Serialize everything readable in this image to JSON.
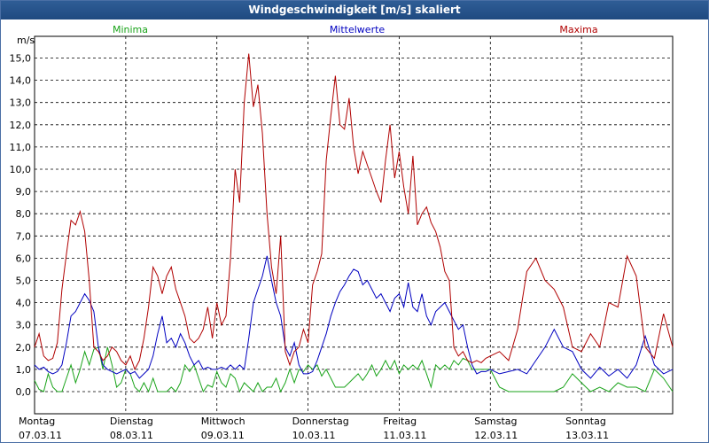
{
  "title": "Windgeschwindigkeit [m/s] skaliert",
  "chart_data": {
    "type": "line",
    "title": "Windgeschwindigkeit [m/s] skaliert",
    "ylabel": "m/s",
    "ylim": [
      0,
      15.5
    ],
    "y_ticks": [
      "0,0",
      "1,0",
      "2,0",
      "3,0",
      "4,0",
      "5,0",
      "6,0",
      "7,0",
      "8,0",
      "9,0",
      "10,0",
      "11,0",
      "12,0",
      "13,0",
      "14,0",
      "15,0"
    ],
    "x_days": [
      {
        "weekday": "Montag",
        "date": "07.03.11"
      },
      {
        "weekday": "Dienstag",
        "date": "08.03.11"
      },
      {
        "weekday": "Mittwoch",
        "date": "09.03.11"
      },
      {
        "weekday": "Donnerstag",
        "date": "10.03.11"
      },
      {
        "weekday": "Freitag",
        "date": "11.03.11"
      },
      {
        "weekday": "Samstag",
        "date": "12.03.11"
      },
      {
        "weekday": "Sonntag",
        "date": "13.03.11"
      }
    ],
    "x_unit": "days since 07.03.11 00:00",
    "grid": true,
    "series": [
      {
        "name": "Minima",
        "color": "#1aa31a",
        "x": [
          0,
          0.05,
          0.1,
          0.15,
          0.2,
          0.25,
          0.3,
          0.35,
          0.4,
          0.45,
          0.5,
          0.55,
          0.6,
          0.65,
          0.7,
          0.75,
          0.8,
          0.85,
          0.9,
          0.95,
          1.0,
          1.05,
          1.1,
          1.15,
          1.2,
          1.25,
          1.3,
          1.35,
          1.4,
          1.45,
          1.5,
          1.55,
          1.6,
          1.65,
          1.7,
          1.75,
          1.8,
          1.85,
          1.9,
          1.95,
          2.0,
          2.05,
          2.1,
          2.15,
          2.2,
          2.25,
          2.3,
          2.35,
          2.4,
          2.45,
          2.5,
          2.55,
          2.6,
          2.65,
          2.7,
          2.75,
          2.8,
          2.85,
          2.9,
          2.95,
          3.0,
          3.05,
          3.1,
          3.15,
          3.2,
          3.25,
          3.3,
          3.35,
          3.4,
          3.45,
          3.5,
          3.55,
          3.6,
          3.65,
          3.7,
          3.75,
          3.8,
          3.85,
          3.9,
          3.95,
          4.0,
          4.05,
          4.1,
          4.15,
          4.2,
          4.25,
          4.3,
          4.35,
          4.4,
          4.45,
          4.5,
          4.55,
          4.6,
          4.65,
          4.7,
          4.75,
          4.8,
          4.85,
          4.9,
          4.95,
          5.0,
          5.1,
          5.2,
          5.3,
          5.4,
          5.5,
          5.6,
          5.7,
          5.8,
          5.9,
          6.0,
          6.1,
          6.2,
          6.3,
          6.4,
          6.5,
          6.6,
          6.7,
          6.8,
          6.9,
          7.0
        ],
        "values": [
          0.5,
          0.1,
          0.0,
          0.8,
          0.2,
          0.0,
          0.0,
          0.6,
          1.2,
          0.4,
          1.0,
          1.8,
          1.2,
          1.9,
          2.0,
          1.0,
          2.0,
          1.2,
          0.2,
          0.4,
          1.0,
          0.8,
          0.2,
          0.0,
          0.4,
          0.0,
          0.6,
          0.0,
          0.0,
          0.0,
          0.2,
          0.0,
          0.4,
          1.2,
          0.9,
          1.2,
          0.6,
          0.0,
          0.3,
          0.2,
          0.9,
          0.4,
          0.2,
          0.8,
          0.6,
          0.0,
          0.4,
          0.2,
          0.0,
          0.4,
          0.0,
          0.2,
          0.2,
          0.6,
          0.0,
          0.4,
          1.0,
          0.4,
          1.0,
          0.9,
          1.2,
          1.0,
          1.2,
          0.7,
          1.0,
          0.6,
          0.2,
          0.2,
          0.2,
          0.4,
          0.6,
          0.8,
          0.5,
          0.8,
          1.2,
          0.7,
          1.0,
          1.4,
          1.0,
          1.4,
          0.8,
          1.2,
          1.0,
          1.2,
          1.0,
          1.4,
          0.8,
          0.2,
          1.2,
          1.0,
          1.2,
          1.0,
          1.4,
          1.2,
          1.5,
          1.4,
          1.0,
          1.0,
          1.0,
          1.0,
          1.0,
          0.2,
          0.0,
          0.0,
          0.0,
          0.0,
          0.0,
          0.0,
          0.2,
          0.8,
          0.4,
          0.0,
          0.2,
          0.0,
          0.4,
          0.2,
          0.2,
          0.0,
          1.0,
          0.6,
          0.0
        ]
      },
      {
        "name": "Mittelwerte",
        "color": "#0000c0",
        "x": [
          0,
          0.05,
          0.1,
          0.15,
          0.2,
          0.25,
          0.3,
          0.35,
          0.4,
          0.45,
          0.5,
          0.55,
          0.6,
          0.65,
          0.7,
          0.75,
          0.8,
          0.85,
          0.9,
          0.95,
          1.0,
          1.05,
          1.1,
          1.15,
          1.2,
          1.25,
          1.3,
          1.35,
          1.4,
          1.45,
          1.5,
          1.55,
          1.6,
          1.65,
          1.7,
          1.75,
          1.8,
          1.85,
          1.9,
          1.95,
          2.0,
          2.05,
          2.1,
          2.15,
          2.2,
          2.25,
          2.3,
          2.35,
          2.4,
          2.45,
          2.5,
          2.55,
          2.6,
          2.65,
          2.7,
          2.75,
          2.8,
          2.85,
          2.9,
          2.95,
          3.0,
          3.05,
          3.1,
          3.15,
          3.2,
          3.25,
          3.3,
          3.35,
          3.4,
          3.45,
          3.5,
          3.55,
          3.6,
          3.65,
          3.7,
          3.75,
          3.8,
          3.85,
          3.9,
          3.95,
          4.0,
          4.05,
          4.1,
          4.15,
          4.2,
          4.25,
          4.3,
          4.35,
          4.4,
          4.45,
          4.5,
          4.55,
          4.6,
          4.65,
          4.7,
          4.75,
          4.8,
          4.85,
          4.9,
          4.95,
          5.0,
          5.1,
          5.2,
          5.3,
          5.4,
          5.5,
          5.6,
          5.7,
          5.8,
          5.9,
          6.0,
          6.1,
          6.2,
          6.3,
          6.4,
          6.5,
          6.6,
          6.7,
          6.8,
          6.9,
          7.0
        ],
        "values": [
          1.2,
          1.0,
          1.1,
          0.9,
          0.8,
          0.9,
          1.2,
          2.2,
          3.4,
          3.6,
          4.0,
          4.4,
          4.1,
          3.6,
          2.0,
          1.2,
          1.0,
          0.9,
          0.8,
          0.9,
          1.0,
          0.8,
          0.9,
          0.6,
          0.8,
          1.0,
          1.6,
          2.6,
          3.4,
          2.2,
          2.4,
          2.0,
          2.6,
          2.2,
          1.6,
          1.2,
          1.4,
          1.0,
          1.1,
          1.0,
          1.0,
          1.1,
          1.0,
          1.2,
          1.0,
          1.2,
          1.0,
          2.4,
          4.0,
          4.6,
          5.2,
          6.1,
          5.0,
          4.0,
          3.4,
          2.0,
          1.6,
          2.2,
          1.2,
          0.8,
          0.8,
          0.9,
          1.4,
          2.0,
          2.6,
          3.4,
          4.0,
          4.5,
          4.8,
          5.2,
          5.5,
          5.4,
          4.8,
          5.0,
          4.6,
          4.2,
          4.4,
          4.0,
          3.6,
          4.2,
          4.4,
          3.8,
          4.9,
          3.8,
          3.6,
          4.4,
          3.4,
          3.0,
          3.6,
          3.8,
          4.0,
          3.6,
          3.2,
          2.8,
          3.0,
          2.0,
          1.2,
          0.8,
          0.9,
          0.9,
          1.0,
          0.8,
          0.9,
          1.0,
          0.8,
          1.4,
          2.0,
          2.8,
          2.0,
          1.8,
          1.0,
          0.6,
          1.1,
          0.7,
          1.0,
          0.6,
          1.2,
          2.5,
          1.2,
          0.8,
          1.0
        ]
      },
      {
        "name": "Maxima",
        "color": "#b00000",
        "x": [
          0,
          0.05,
          0.1,
          0.15,
          0.2,
          0.25,
          0.3,
          0.35,
          0.4,
          0.45,
          0.5,
          0.55,
          0.6,
          0.65,
          0.7,
          0.75,
          0.8,
          0.85,
          0.9,
          0.95,
          1.0,
          1.05,
          1.1,
          1.15,
          1.2,
          1.25,
          1.3,
          1.35,
          1.4,
          1.45,
          1.5,
          1.55,
          1.6,
          1.65,
          1.7,
          1.75,
          1.8,
          1.85,
          1.9,
          1.95,
          2.0,
          2.05,
          2.1,
          2.15,
          2.2,
          2.25,
          2.3,
          2.35,
          2.4,
          2.45,
          2.5,
          2.55,
          2.6,
          2.65,
          2.7,
          2.75,
          2.8,
          2.85,
          2.9,
          2.95,
          3.0,
          3.05,
          3.1,
          3.15,
          3.2,
          3.25,
          3.3,
          3.35,
          3.4,
          3.45,
          3.5,
          3.55,
          3.6,
          3.65,
          3.7,
          3.75,
          3.8,
          3.85,
          3.9,
          3.95,
          4.0,
          4.05,
          4.1,
          4.15,
          4.2,
          4.25,
          4.3,
          4.35,
          4.4,
          4.45,
          4.5,
          4.55,
          4.6,
          4.65,
          4.7,
          4.75,
          4.8,
          4.85,
          4.9,
          4.95,
          5.0,
          5.1,
          5.2,
          5.3,
          5.4,
          5.5,
          5.6,
          5.7,
          5.8,
          5.9,
          6.0,
          6.1,
          6.2,
          6.3,
          6.4,
          6.5,
          6.6,
          6.7,
          6.8,
          6.9,
          7.0
        ],
        "values": [
          2.0,
          2.6,
          1.6,
          1.4,
          1.5,
          2.2,
          4.6,
          6.2,
          7.7,
          7.5,
          8.1,
          7.2,
          5.0,
          2.0,
          1.8,
          1.4,
          1.6,
          2.0,
          1.8,
          1.4,
          1.2,
          1.6,
          1.0,
          1.4,
          2.4,
          3.8,
          5.6,
          5.2,
          4.4,
          5.2,
          5.6,
          4.6,
          4.0,
          3.4,
          2.4,
          2.2,
          2.4,
          2.8,
          3.8,
          2.4,
          4.0,
          3.0,
          3.4,
          6.0,
          10.0,
          8.5,
          13.0,
          15.2,
          12.8,
          13.8,
          11.6,
          8.0,
          5.6,
          4.4,
          7.0,
          1.8,
          1.2,
          1.8,
          2.0,
          2.8,
          2.2,
          4.8,
          5.4,
          6.2,
          10.4,
          12.4,
          14.2,
          12.0,
          11.8,
          13.2,
          11.0,
          9.8,
          10.8,
          10.2,
          9.6,
          9.0,
          8.5,
          10.4,
          12.0,
          9.6,
          10.8,
          9.2,
          8.0,
          10.6,
          7.5,
          8.0,
          8.3,
          7.6,
          7.2,
          6.5,
          5.4,
          5.0,
          2.0,
          1.6,
          1.8,
          1.4,
          1.3,
          1.4,
          1.3,
          1.5,
          1.6,
          1.8,
          1.4,
          2.8,
          5.4,
          6.0,
          5.0,
          4.6,
          3.8,
          2.0,
          1.8,
          2.6,
          2.0,
          4.0,
          3.8,
          6.1,
          5.2,
          2.0,
          1.5,
          3.5,
          2.0
        ]
      }
    ]
  }
}
